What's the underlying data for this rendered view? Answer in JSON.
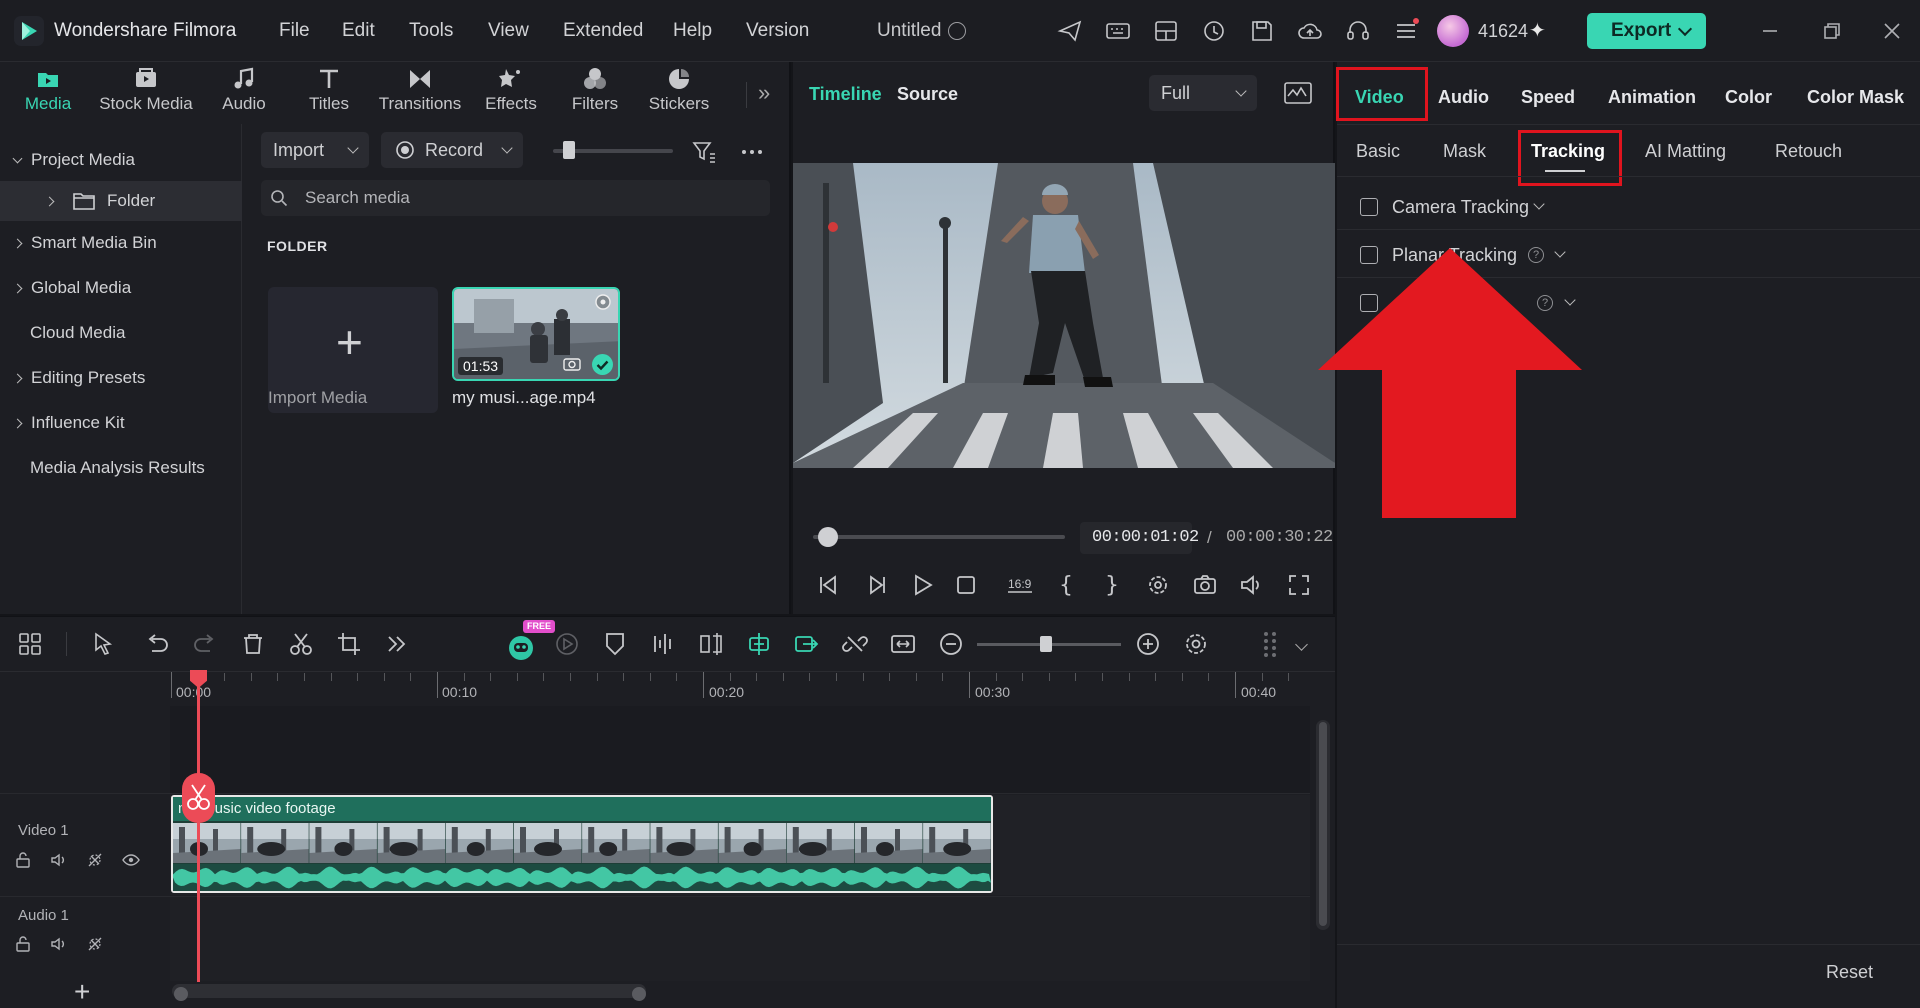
{
  "titlebar": {
    "app_name": "Wondershare Filmora",
    "menu": [
      "File",
      "Edit",
      "Tools",
      "View",
      "Extended",
      "Help",
      "Version"
    ],
    "document_title": "Untitled",
    "user_count": "41624",
    "export_label": "Export"
  },
  "tool_tabs": [
    {
      "label": "Media",
      "icon": "media-folder-icon"
    },
    {
      "label": "Stock Media",
      "icon": "stock-media-icon"
    },
    {
      "label": "Audio",
      "icon": "music-note-icon"
    },
    {
      "label": "Titles",
      "icon": "title-t-icon"
    },
    {
      "label": "Transitions",
      "icon": "transitions-icon"
    },
    {
      "label": "Effects",
      "icon": "effects-icon"
    },
    {
      "label": "Filters",
      "icon": "filters-icon"
    },
    {
      "label": "Stickers",
      "icon": "stickers-icon"
    }
  ],
  "sidebar": {
    "items": [
      {
        "label": "Project Media"
      },
      {
        "label": "Folder"
      },
      {
        "label": "Smart Media Bin"
      },
      {
        "label": "Global Media"
      },
      {
        "label": "Cloud Media"
      },
      {
        "label": "Editing Presets"
      },
      {
        "label": "Influence Kit"
      },
      {
        "label": "Media Analysis Results"
      }
    ]
  },
  "media": {
    "import_label": "Import",
    "record_label": "Record",
    "search_placeholder": "Search media",
    "folder_heading": "FOLDER",
    "import_media_caption": "Import Media",
    "clip_duration": "01:53",
    "clip_name": "my musi...age.mp4"
  },
  "preview": {
    "timeline_tab": "Timeline",
    "source_tab": "Source",
    "quality": "Full",
    "current_time": "00:00:01:02",
    "separator": "/",
    "total_time": "00:00:30:22",
    "aspect_label": "16:9",
    "scrub_fraction": 0.04
  },
  "right_panel": {
    "tabs": [
      "Video",
      "Audio",
      "Speed",
      "Animation",
      "Color",
      "Color Mask"
    ],
    "subtabs": [
      "Basic",
      "Mask",
      "Tracking",
      "AI Matting",
      "Retouch"
    ],
    "active_tab": "Video",
    "active_subtab": "Tracking",
    "options": [
      {
        "label": "Camera Tracking"
      },
      {
        "label": "Planar Tracking"
      },
      {
        "label": ""
      }
    ],
    "reset_label": "Reset"
  },
  "timeline": {
    "free_badge": "FREE",
    "ruler_labels": [
      "00:00",
      "00:10",
      "00:20",
      "00:30",
      "00:40"
    ],
    "tracks": [
      {
        "name": "Video 1"
      },
      {
        "name": "Audio 1"
      }
    ],
    "clip_title": "my music video footage",
    "add_label": "+"
  },
  "colors": {
    "accent": "#39d6b3",
    "highlight": "#e0141e",
    "playhead": "#ec4b57"
  }
}
